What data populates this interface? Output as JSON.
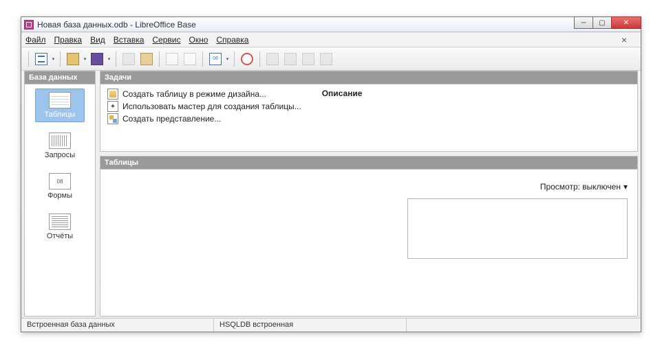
{
  "title": "Новая база данных.odb - LibreOffice Base",
  "menu": {
    "file": "Файл",
    "edit": "Правка",
    "view": "Вид",
    "insert": "Вставка",
    "tools": "Сервис",
    "window": "Окно",
    "help": "Справка"
  },
  "sidebar": {
    "header": "База данных",
    "items": [
      {
        "label": "Таблицы",
        "selected": true,
        "icon": "tables"
      },
      {
        "label": "Запросы",
        "selected": false,
        "icon": "queries"
      },
      {
        "label": "Формы",
        "selected": false,
        "icon": "forms"
      },
      {
        "label": "Отчёты",
        "selected": false,
        "icon": "reports"
      }
    ]
  },
  "tasks": {
    "header": "Задачи",
    "items": [
      {
        "label": "Создать таблицу в режиме дизайна...",
        "icon": "design"
      },
      {
        "label": "Использовать мастер для создания таблицы...",
        "icon": "wizard"
      },
      {
        "label": "Создать представление...",
        "icon": "view"
      }
    ],
    "description_title": "Описание"
  },
  "tables": {
    "header": "Таблицы",
    "preview_label": "Просмотр: выключен"
  },
  "status": {
    "left": "Встроенная база данных",
    "mid": "HSQLDB встроенная"
  }
}
